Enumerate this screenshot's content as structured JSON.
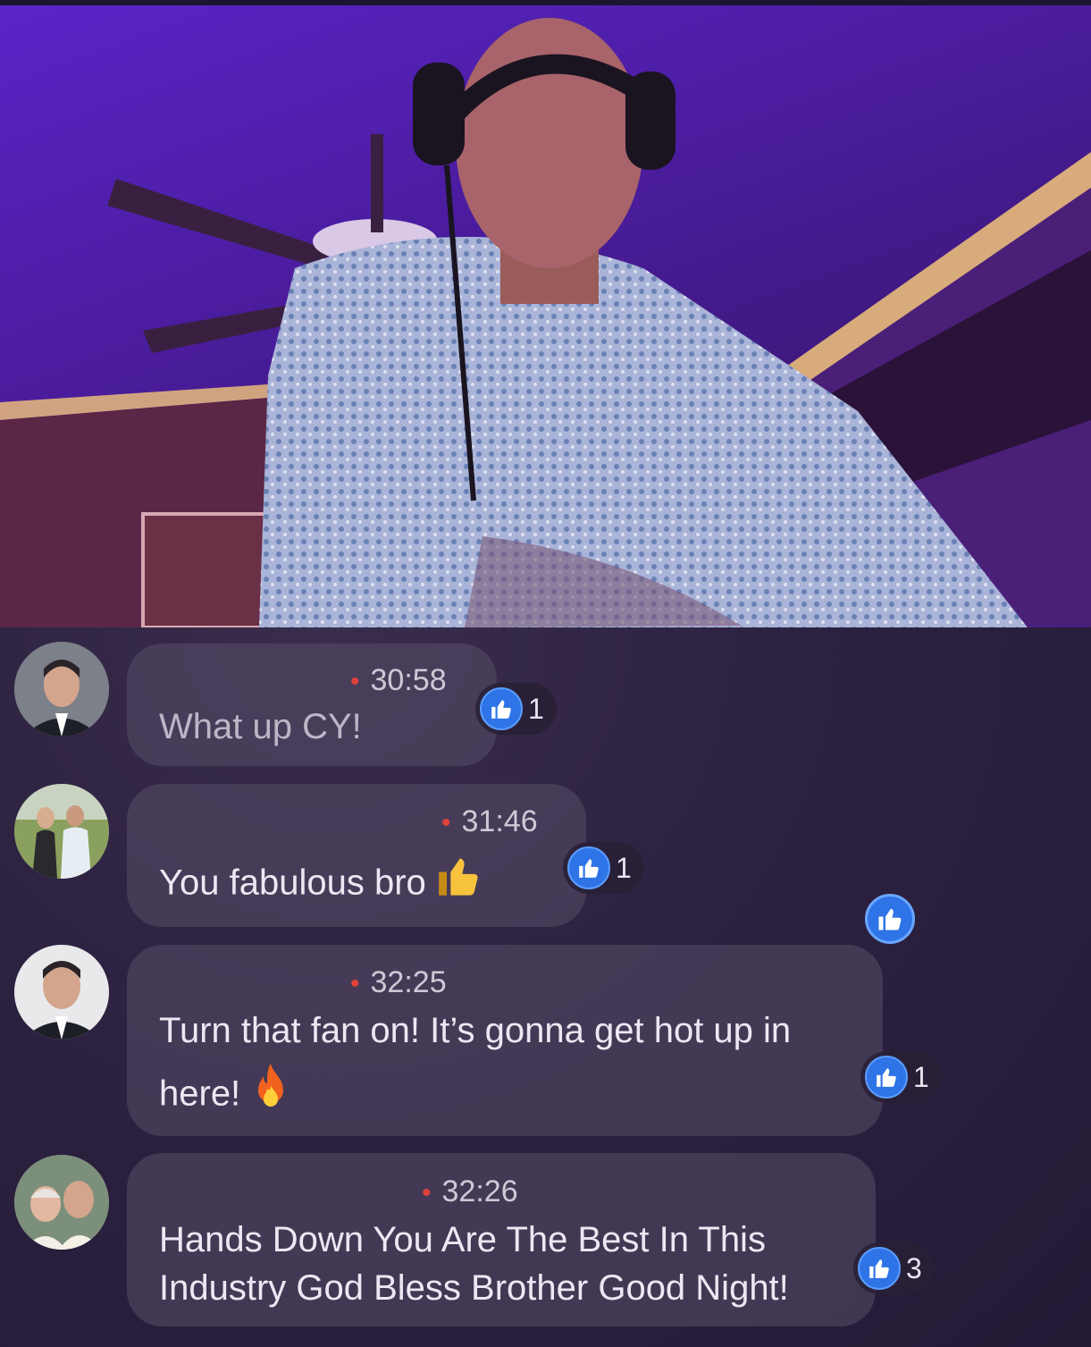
{
  "colors": {
    "accent_like": "#2f74e6",
    "live_dot": "#e0413a",
    "bubble": "#584e68",
    "background": "#2a2036"
  },
  "icons": {
    "like": "thumbs-up-icon",
    "thumbs_up_emoji": "thumbs-up-emoji",
    "fire_emoji": "fire-emoji"
  },
  "comments": [
    {
      "time": "30:58",
      "text": "What up CY!",
      "likes": "1"
    },
    {
      "time": "31:46",
      "text": "You fabulous bro",
      "likes": "1"
    },
    {
      "time": "32:25",
      "text_line1": "Turn that fan on! It’s gonna get hot up in",
      "text_line2": "here!",
      "likes": "1"
    },
    {
      "time": "32:26",
      "text_line1": "Hands Down You Are The Best In This",
      "text_line2": "Industry God Bless Brother Good Night!",
      "likes": "3"
    }
  ]
}
